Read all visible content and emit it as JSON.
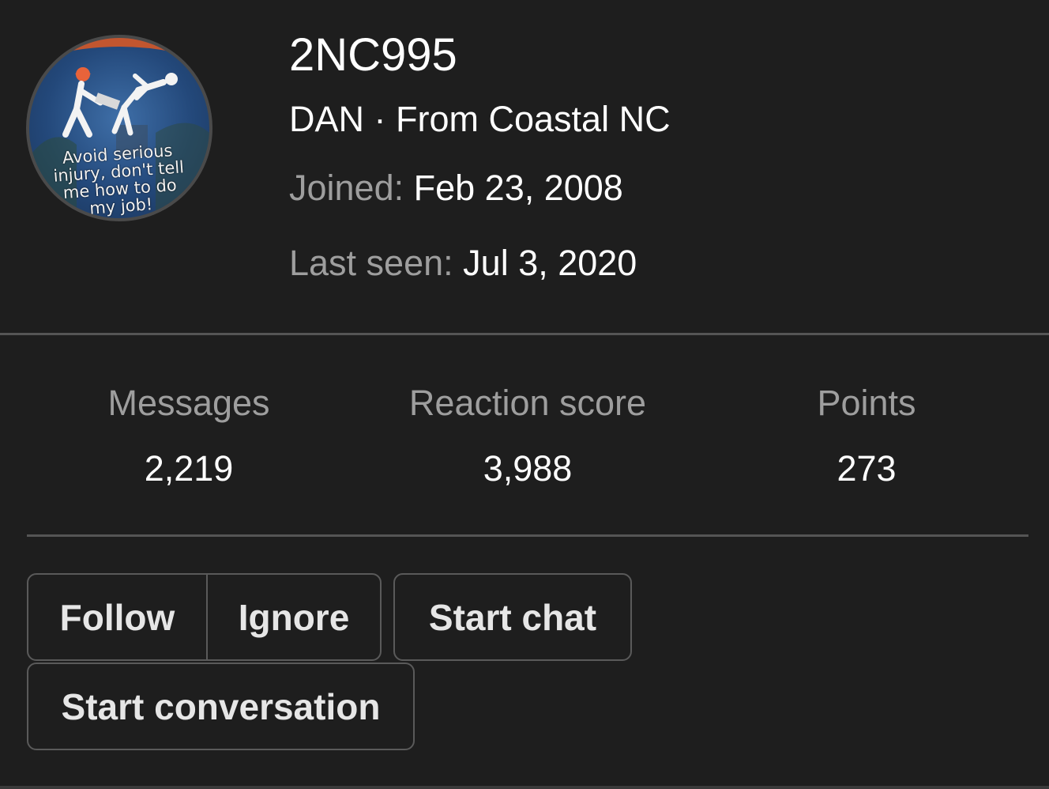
{
  "profile": {
    "username": "2NC995",
    "subtitle": "DAN · From Coastal NC",
    "joined_label": "Joined:",
    "joined_value": "Feb 23, 2008",
    "last_seen_label": "Last seen:",
    "last_seen_value": "Jul 3, 2020",
    "avatar": {
      "icon": "warning-sign-avatar-icon",
      "caption_lines": [
        "Avoid serious",
        "injury, don't tell",
        "me how to do",
        "my job!"
      ]
    }
  },
  "stats": [
    {
      "label": "Messages",
      "value": "2,219"
    },
    {
      "label": "Reaction score",
      "value": "3,988"
    },
    {
      "label": "Points",
      "value": "273"
    }
  ],
  "actions": {
    "follow": "Follow",
    "ignore": "Ignore",
    "start_chat": "Start chat",
    "start_conversation": "Start conversation"
  },
  "colors": {
    "background": "#1e1e1e",
    "muted_text": "#9e9e9e",
    "primary_text": "#ffffff",
    "border": "#5a5a5a"
  }
}
